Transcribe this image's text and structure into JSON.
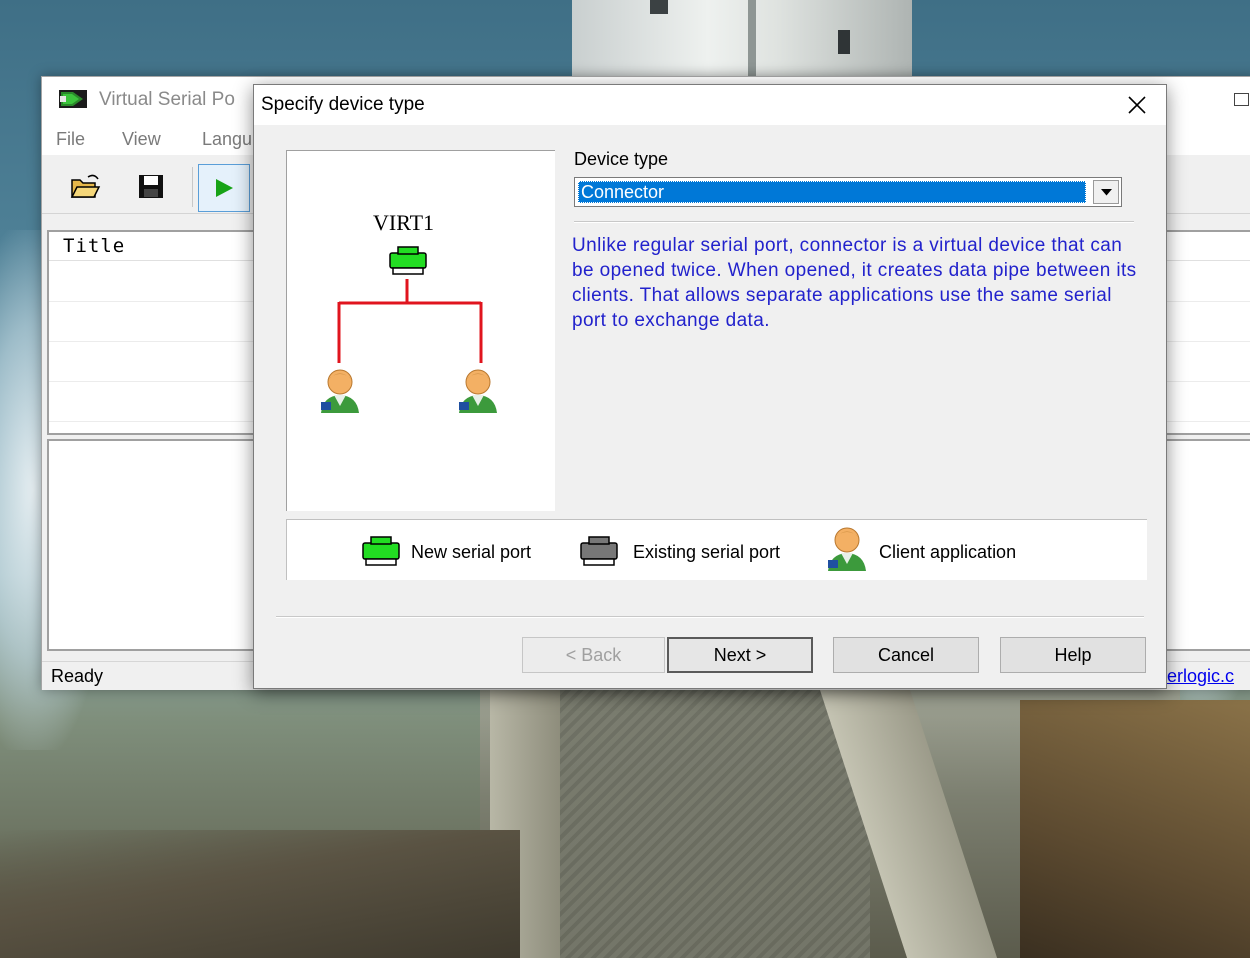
{
  "main_window": {
    "title": "Virtual Serial Po",
    "menu": [
      "File",
      "View",
      "Langu"
    ],
    "list_column": "Title",
    "status": "Ready",
    "status_link": "terlogic.c"
  },
  "dialog": {
    "title": "Specify device type",
    "preview": {
      "port_name": "VIRT1"
    },
    "device_type_label": "Device type",
    "device_type_value": "Connector",
    "description": "Unlike regular serial port, connector is a virtual device that can be opened twice. When opened, it creates data pipe between its clients. That allows separate applications use the same serial port to exchange data.",
    "legend": {
      "new_port": "New serial port",
      "existing_port": "Existing serial port",
      "client_app": "Client application"
    },
    "buttons": {
      "back": "< Back",
      "next": "Next >",
      "cancel": "Cancel",
      "help": "Help"
    }
  },
  "colors": {
    "selection": "#0078d7",
    "description_text": "#2222cc",
    "new_port_icon": "#22dd22",
    "existing_port_icon": "#777777",
    "tree_line": "#e0141e"
  },
  "icons": [
    "app-icon",
    "open-folder-icon",
    "save-disk-icon",
    "play-icon",
    "maximize-icon",
    "close-icon",
    "chevron-down-icon",
    "new-serial-port-icon",
    "existing-serial-port-icon",
    "client-application-icon"
  ]
}
